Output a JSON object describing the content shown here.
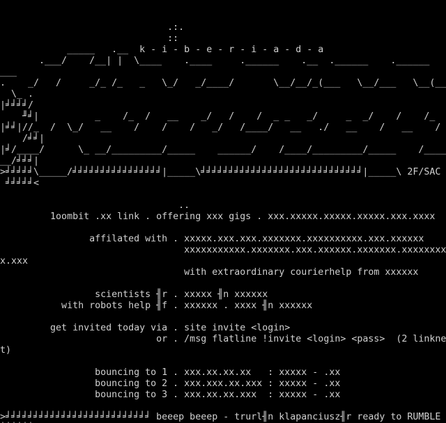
{
  "screen": {
    "background": "#000000",
    "foreground": "#d0d0d0",
    "lines": [
      "",
      "",
      "                              .:.",
      "                              ::",
      "            _____   .__  k - i - b - e - r - i - a - d - a",
      "       .___/    /__| |  \\____    .____     .______    .__  .______    .______    __._",
      "___",
      ".    _/   /     _/_ /_   _   \\_/   _/____/       \\__/__/_(___   \\__/___   \\__(____",
      "  \\_ .",
      "|╛╛╛╛/",
      "    ╜╛|          _    /_  /   __    _/   /    /  _ _   _/     _  _/    /    /_",
      "|╛╛|//_  /  \\_/   __    /    /    /   _/   /____/   __   ./   __    /   __    /",
      "    /╛╛|",
      "|╛/____/      \\_ __/_________/_____    ______/    /____/_________/_____    /_______",
      "__/╛╛╛|",
      ">╛╛╛╛╛\\_____/╛╛╛╛╛╛╛╛╛╛╛╛╛╛╛╛|_____\\╛╛╛╛╛╛╛╛╛╛╛╛╛╛╛╛╛╛╛╛╛╛╛╛╛╛╛╛╛|_____\\ 2F/SAC",
      " ╛╛╛╛╛<",
      "",
      "                                ..",
      "         1oombit .xx link . offering xxx gigs . xxx.xxxxx.xxxxx.xxxxx.xxx.xxxx",
      "",
      "                affilated with . xxxxx.xxx.xxx.xxxxxxx.xxxxxxxxxx.xxx.xxxxxx",
      "                                 xxxxxxxxxxx.xxxxxxx.xxx.xxxxxx.xxxxxxx.xxxxxxxx",
      "x.xxx",
      "                                 with extraordinary courierhelp from xxxxxx",
      "",
      "                 scientists ╢r . xxxxx ╢n xxxxxx",
      "           with robots help ╢f . xxxxxx . xxxx ╢n xxxxxx",
      "",
      "         get invited today via . site invite <login>",
      "                            or . /msg flatline !invite <login> <pass>  (2 linkne",
      "t)",
      "",
      "                 bouncing to 1 . xxx.xx.xx.xx   : xxxxx - .xx",
      "                 bouncing to 2 . xxx.xxx.xx.xxx : xxxxx - .xx",
      "                 bouncing to 3 . xxx.xx.xx.xxx  : xxxxx - .xx",
      "",
      ">╛╛╛╛╛╛╛╛╛╛╛╛╛╛╛╛╛╛╛╛╛╛╛╛╛╛ beeep beeep - trurl╢n klapanciusz╢r ready to RUMBLE",
      "╛╛╛╛╛╛<"
    ]
  }
}
